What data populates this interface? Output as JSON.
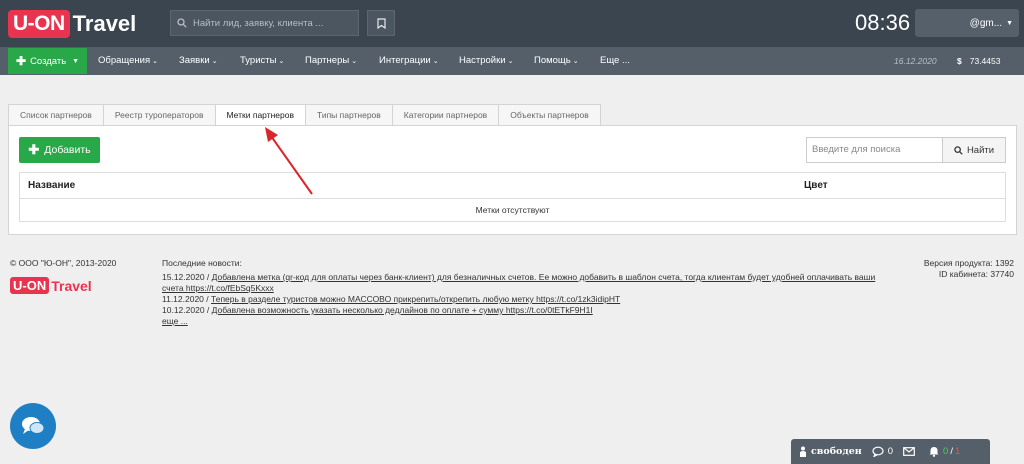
{
  "header": {
    "logo_u": "U-ON",
    "logo_travel": "Travel",
    "search_placeholder": "Найти лид, заявку, клиента ...",
    "clock": "08:36",
    "user": "@gm..."
  },
  "nav": {
    "create": "Создать",
    "items": [
      "Обращения",
      "Заявки",
      "Туристы",
      "Партнеры",
      "Интеграции",
      "Настройки",
      "Помощь",
      "Еще ..."
    ],
    "date": "16.12.2020",
    "currency_symbol": "$",
    "currency_value": "73.4453"
  },
  "tabs": [
    "Список партнеров",
    "Реестр туроператоров",
    "Метки партнеров",
    "Типы партнеров",
    "Категории партнеров",
    "Объекты партнеров"
  ],
  "panel": {
    "add_button": "Добавить",
    "search_placeholder": "Введите для поиска",
    "search_button": "Найти",
    "col_name": "Название",
    "col_color": "Цвет",
    "empty_text": "Метки отсутствуют"
  },
  "footer": {
    "copyright": "© ООО \"Ю-ОН\", 2013-2020",
    "logo_u": "U-ON",
    "logo_travel": "Travel",
    "news_heading": "Последние новости:",
    "news": [
      {
        "date": "15.12.2020 /",
        "text": "Добавлена метка (qr-код для оплаты через банк-клиент) для безналичных счетов. Ее можно добавить в шаблон счета, тогда клиентам будет удобней оплачивать ваши счета https://t.co/fEbSq5Kxxx"
      },
      {
        "date": "11.12.2020 /",
        "text": "Теперь в разделе туристов можно МАССОВО прикрепить/открепить любую метку https://t.co/1zk3idipHT"
      },
      {
        "date": "10.12.2020 /",
        "text": "Добавлена возможность указать несколько дедлайнов по оплате + сумму https://t.co/0tETkF9H1I"
      }
    ],
    "more": "еще ...",
    "version": "Версия продукта: 1392",
    "cabinet_id": "ID кабинета: 37740"
  },
  "statusbar": {
    "status": "свободен",
    "messages": "0",
    "notif_green": "0",
    "notif_sep": "/",
    "notif_red": "1"
  },
  "colors": {
    "header_bg": "#3b4550",
    "nav_bg": "#555f6a",
    "accent_green": "#29a84a",
    "brand_red": "#e8344e",
    "annotation_arrow": "#d9262b"
  }
}
